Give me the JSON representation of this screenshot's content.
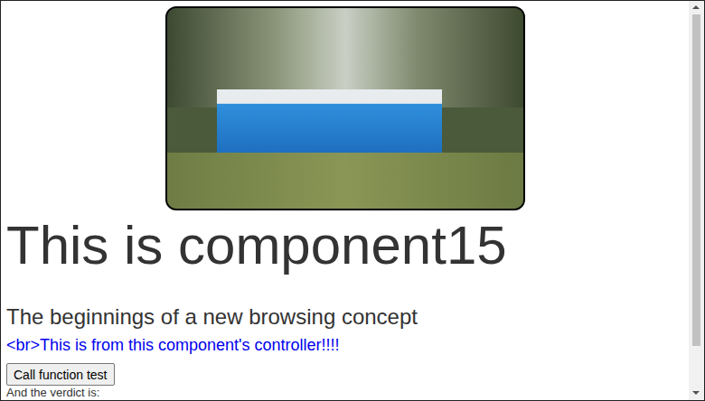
{
  "page": {
    "photo": {
      "alt": ""
    },
    "heading": "This is component15",
    "subheading": "The beginnings of a new browsing concept",
    "controller_message": "<br>This is from this component's controller!!!!",
    "buttons": [
      "Call function test"
    ],
    "verdict_label": "And the verdict is:"
  },
  "scrollbar": {
    "level": 0.89
  }
}
